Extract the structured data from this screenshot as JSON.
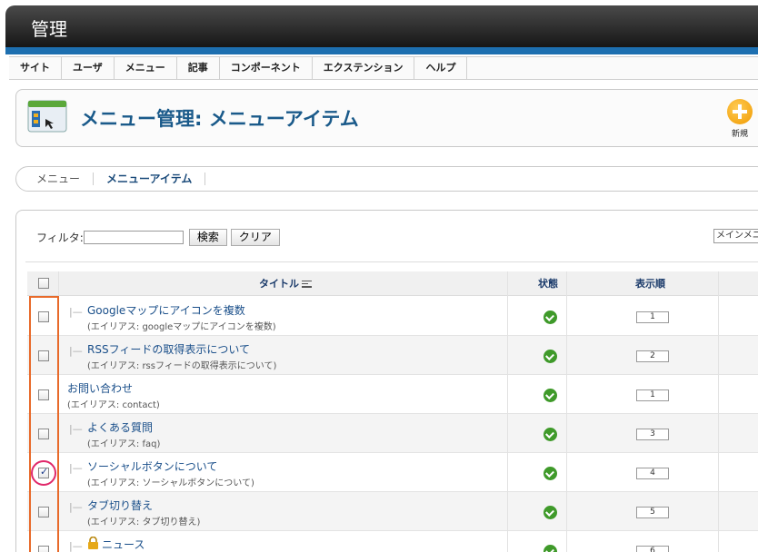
{
  "app": {
    "title": "管理"
  },
  "menubar": {
    "items": [
      "サイト",
      "ユーザ",
      "メニュー",
      "記事",
      "コンポーネント",
      "エクステンション",
      "ヘルプ"
    ]
  },
  "toolbar": {
    "page_title": "メニュー管理: メニューアイテム",
    "new_label": "新規"
  },
  "subnav": {
    "tabs": [
      "メニュー",
      "メニューアイテム"
    ]
  },
  "filter": {
    "label": "フィルタ:",
    "value": "",
    "search_label": "検索",
    "clear_label": "クリア",
    "menu_select": "メインメニュー"
  },
  "table": {
    "headers": {
      "title": "タイトル",
      "status": "状態",
      "order": "表示順"
    },
    "rows": [
      {
        "title": "Googleマップにアイコンを複数",
        "alias": "(エイリアス: googleマップにアイコンを複数)",
        "order": "1",
        "child": true,
        "checked": false,
        "locked": false,
        "status": "published"
      },
      {
        "title": "RSSフィードの取得表示について",
        "alias": "(エイリアス: rssフィードの取得表示について)",
        "order": "2",
        "child": true,
        "checked": false,
        "locked": false,
        "status": "published"
      },
      {
        "title": "お問い合わせ",
        "alias": "(エイリアス: contact)",
        "order": "1",
        "child": false,
        "checked": false,
        "locked": false,
        "status": "published"
      },
      {
        "title": "よくある質問",
        "alias": "(エイリアス: faq)",
        "order": "3",
        "child": true,
        "checked": false,
        "locked": false,
        "status": "published"
      },
      {
        "title": "ソーシャルボタンについて",
        "alias": "(エイリアス: ソーシャルボタンについて)",
        "order": "4",
        "child": true,
        "checked": true,
        "locked": false,
        "status": "published"
      },
      {
        "title": "タブ切り替え",
        "alias": "(エイリアス: タブ切り替え)",
        "order": "5",
        "child": true,
        "checked": false,
        "locked": false,
        "status": "published"
      },
      {
        "title": "ニュース",
        "alias": "",
        "order": "6",
        "child": true,
        "checked": false,
        "locked": true,
        "status": "published"
      }
    ]
  },
  "colors": {
    "header_dark": "#141414",
    "accent_blue": "#1d6fb0",
    "title_blue": "#1a5a8a",
    "status_green": "#3f9a2a",
    "annotation_orange": "#e86a2a",
    "annotation_pink": "#e0286a"
  },
  "icons": {
    "new": "plus-circle-icon",
    "status": "check-circle-icon",
    "page": "menu-manager-icon",
    "lock": "lock-icon"
  }
}
